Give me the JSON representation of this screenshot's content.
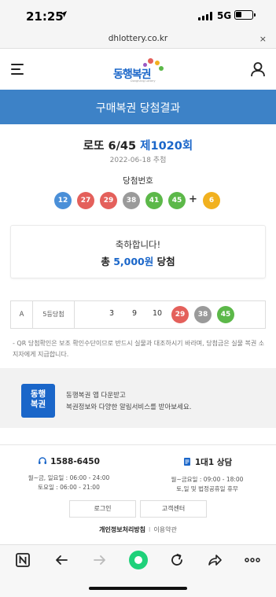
{
  "status": {
    "time": "21:25",
    "network": "5G"
  },
  "browser": {
    "url": "dhlottery.co.kr",
    "close_label": "×"
  },
  "header": {
    "logo_text": "동행복권",
    "logo_sub": "Donghang Lottery"
  },
  "banner": {
    "title": "구매복권 당첨결과"
  },
  "round": {
    "game": "로또 6/45",
    "round_no": "제1020회",
    "date": "2022-06-18 추첨"
  },
  "winning": {
    "label": "당첨번호",
    "numbers": [
      "12",
      "27",
      "29",
      "38",
      "41",
      "45"
    ],
    "plus": "+",
    "bonus": "6",
    "colors": {
      "yellow": "#f1b11f",
      "blue": "#4a8fd8",
      "red": "#e4605b",
      "gray": "#9a9a9a",
      "green": "#5cb849"
    }
  },
  "congrats": {
    "message": "축하합니다!",
    "prefix": "총 ",
    "amount": "5,000원",
    "suffix": " 당첨"
  },
  "result": {
    "game_label": "A",
    "rank": "5등당첨",
    "plain_numbers": [
      "3",
      "9",
      "10"
    ],
    "matched_numbers": [
      "29",
      "38",
      "45"
    ]
  },
  "notice": "- QR 당첨확인은 보조 확인수단이므로 반드시 실물과 대조하시기 바라며, 당첨금은 실물 복권 소지자에게 지급합니다.",
  "promo": {
    "icon_line1": "동행",
    "icon_line2": "복권",
    "line1": "동행복권 앱 다운받고",
    "line2": "복권정보와 다양한 알림서비스를 받아보세요."
  },
  "footer": {
    "phone": {
      "title": "1588-6450",
      "hours1": "월~금, 일요일 : 06:00 - 24:00",
      "hours2": "토요일 : 06:00 - 21:00"
    },
    "consult": {
      "title": "1대1 상담",
      "hours1": "월~금요일 : 09:00 - 18:00",
      "hours2": "토,일 및 법정공휴일 휴무"
    },
    "login_label": "로그인",
    "support_label": "고객센터",
    "privacy_label": "개인정보처리방침",
    "separator": "I",
    "terms_label": "이용약관"
  },
  "toolbar": {
    "icons": [
      "naver-n-icon",
      "back-arrow-icon",
      "forward-arrow-icon",
      "green-home-icon",
      "reload-icon",
      "share-icon",
      "more-icon"
    ]
  }
}
